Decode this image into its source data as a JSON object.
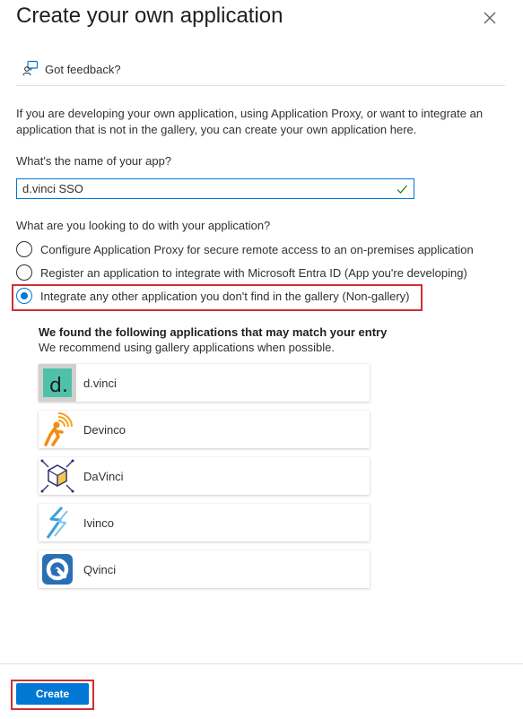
{
  "header": {
    "title": "Create your own application",
    "close_icon": "close-icon"
  },
  "feedback": {
    "label": "Got feedback?",
    "icon": "feedback-icon"
  },
  "intro_text": "If you are developing your own application, using Application Proxy, or want to integrate an application that is not in the gallery, you can create your own application here.",
  "app_name": {
    "label": "What's the name of your app?",
    "value": "d.vinci SSO",
    "valid_icon": "checkmark-icon"
  },
  "purpose": {
    "label": "What are you looking to do with your application?",
    "options": [
      {
        "label": "Configure Application Proxy for secure remote access to an on-premises application",
        "selected": false
      },
      {
        "label": "Register an application to integrate with Microsoft Entra ID (App you're developing)",
        "selected": false
      },
      {
        "label": "Integrate any other application you don't find in the gallery (Non-gallery)",
        "selected": true
      }
    ]
  },
  "matches": {
    "heading": "We found the following applications that may match your entry",
    "subheading": "We recommend using gallery applications when possible.",
    "apps": [
      {
        "name": "d.vinci",
        "icon": "dvinci-logo"
      },
      {
        "name": "Devinco",
        "icon": "devinco-logo"
      },
      {
        "name": "DaVinci",
        "icon": "davinci-logo"
      },
      {
        "name": "Ivinco",
        "icon": "ivinco-logo"
      },
      {
        "name": "Qvinci",
        "icon": "qvinci-logo"
      }
    ]
  },
  "footer": {
    "create_label": "Create"
  },
  "colors": {
    "accent": "#0078d4",
    "highlight": "#d32f2f",
    "valid": "#107c10"
  }
}
